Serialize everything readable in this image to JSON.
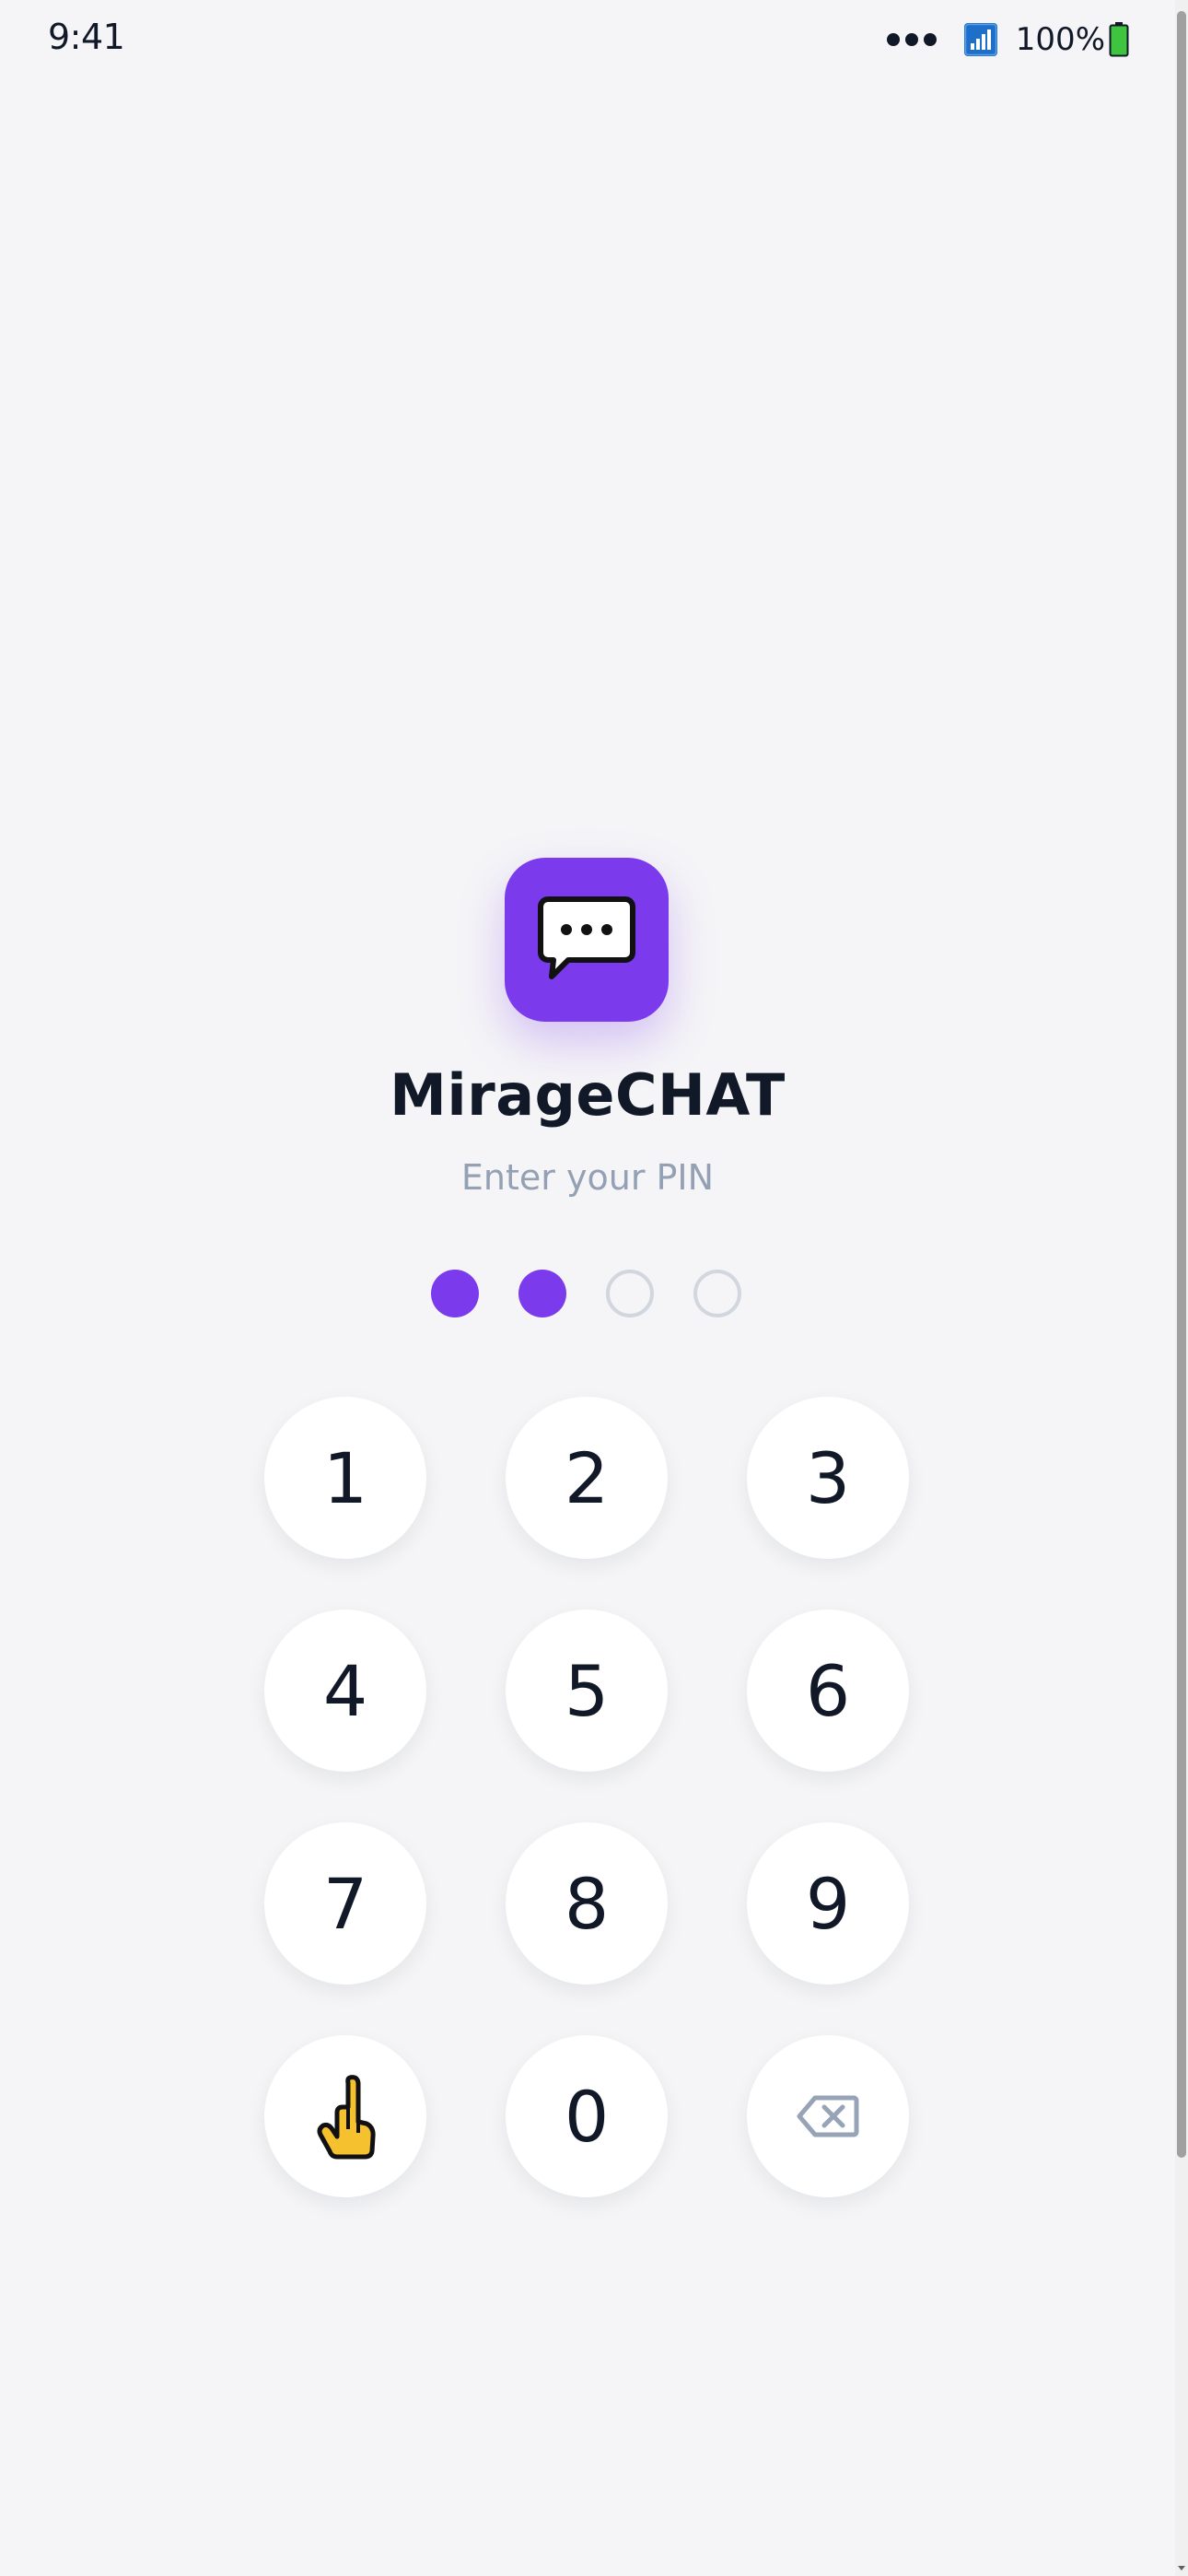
{
  "status_bar": {
    "time": "9:41",
    "battery": "100%",
    "icons": [
      "more-dots-icon",
      "signal-icon",
      "battery-icon"
    ]
  },
  "app": {
    "icon": "chat-bubble-icon",
    "title": "MirageCHAT",
    "subtitle": "Enter your PIN",
    "accent_color": "#7c3aed"
  },
  "pin": {
    "length": 4,
    "entered": 2
  },
  "keypad": {
    "keys": [
      {
        "label": "1"
      },
      {
        "label": "2"
      },
      {
        "label": "3"
      },
      {
        "label": "4"
      },
      {
        "label": "5"
      },
      {
        "label": "6"
      },
      {
        "label": "7"
      },
      {
        "label": "8"
      },
      {
        "label": "9"
      },
      {
        "label": "",
        "icon": "fingerprint-pointing-hand-icon"
      },
      {
        "label": "0"
      },
      {
        "label": "",
        "icon": "backspace-icon"
      }
    ]
  }
}
